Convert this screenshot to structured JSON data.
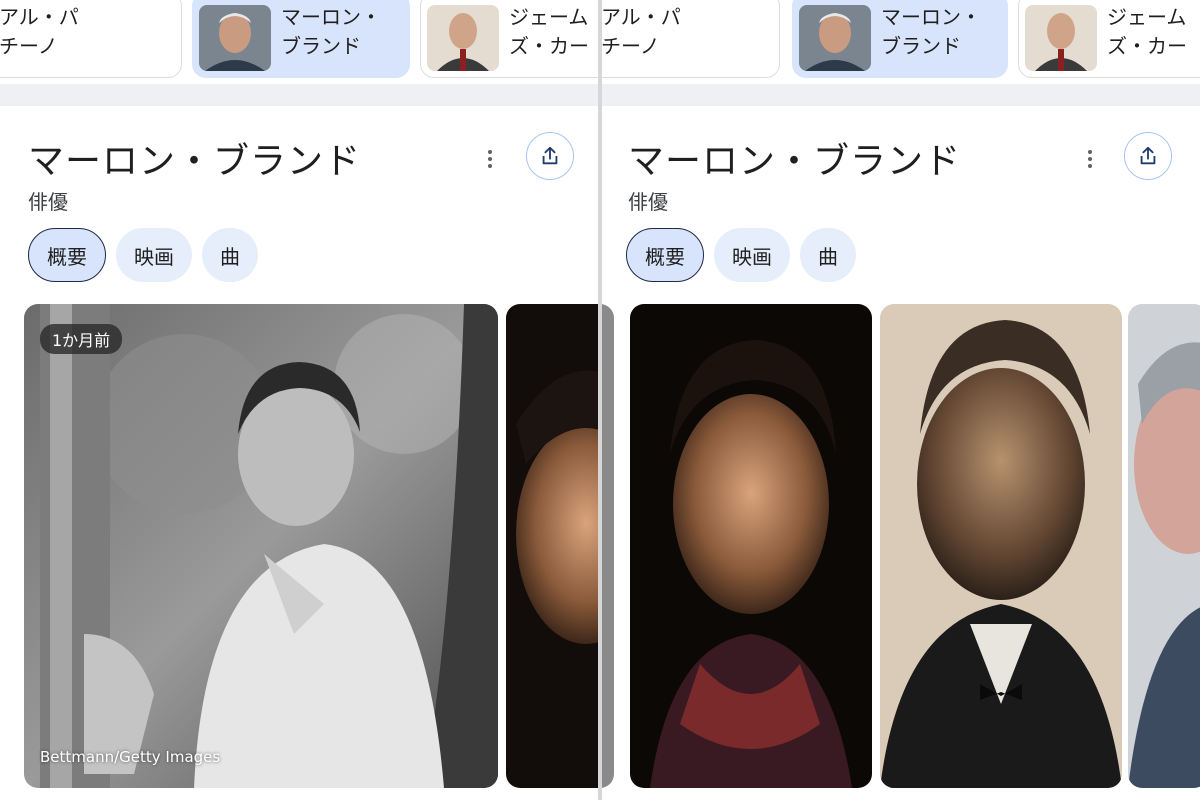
{
  "carousel": [
    {
      "label": "アル・パ\nチーノ",
      "active": false
    },
    {
      "label": "マーロン・\nブランド",
      "active": true
    },
    {
      "label": "ジェーム\nズ・カー",
      "active": false
    }
  ],
  "entity": {
    "name": "マーロン・ブランド",
    "description": "俳優"
  },
  "tabs": [
    "概要",
    "映画",
    "曲"
  ],
  "photo": {
    "timestamp": "1か月前",
    "credit": "Bettmann/Getty Images"
  },
  "icons": {
    "more": "more-vert-icon",
    "share": "share-icon"
  }
}
